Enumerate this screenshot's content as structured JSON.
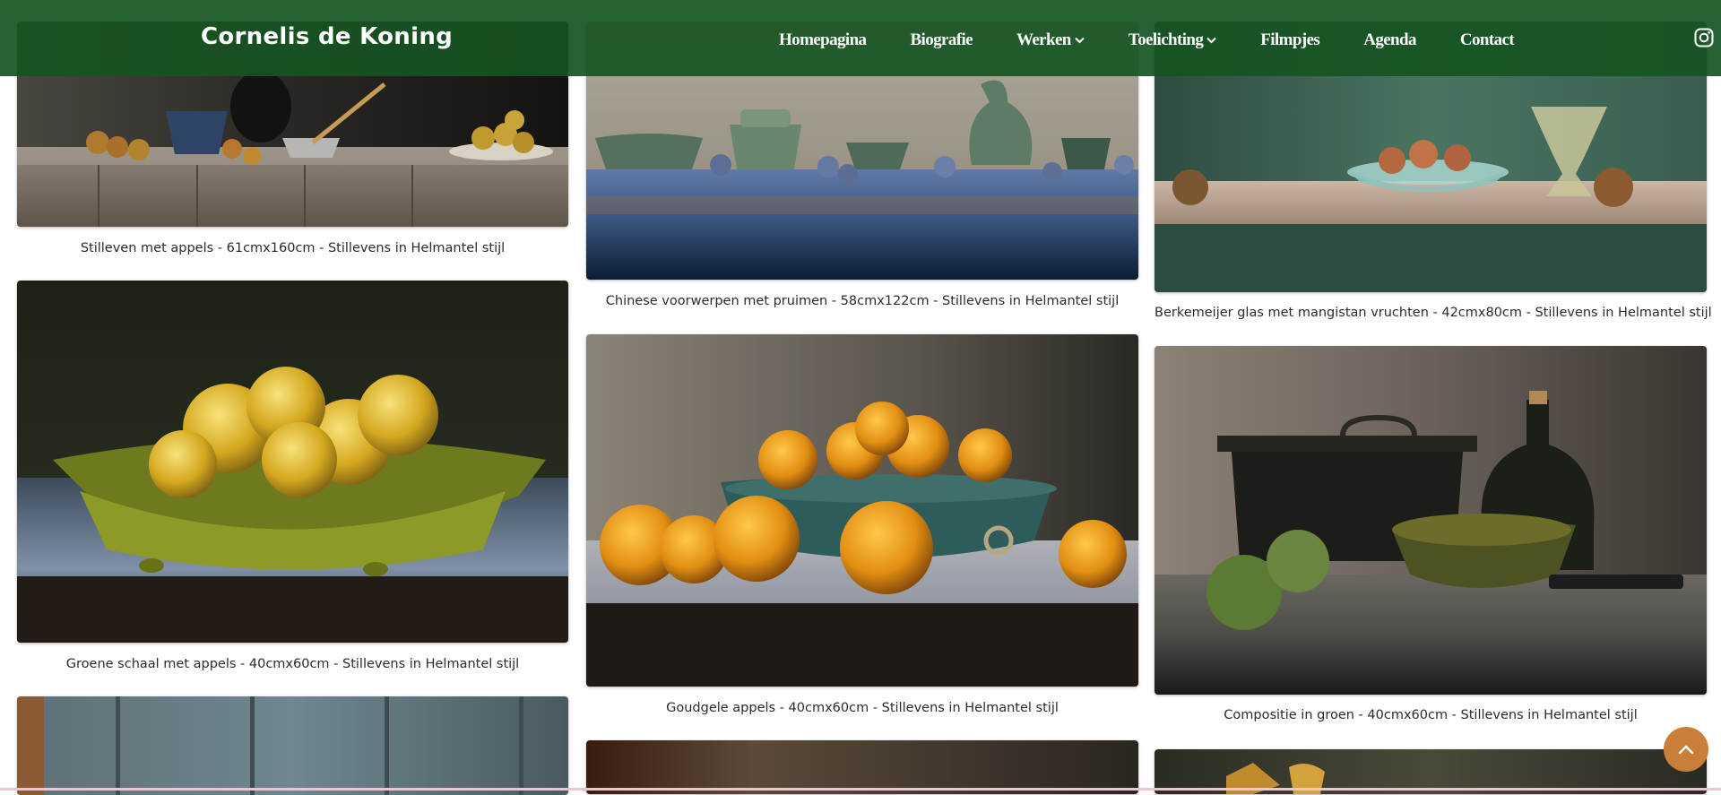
{
  "site": {
    "title": "Cornelis de Koning"
  },
  "nav": {
    "items": [
      {
        "label": "Homepagina",
        "dropdown": false
      },
      {
        "label": "Biografie",
        "dropdown": false
      },
      {
        "label": "Werken",
        "dropdown": true
      },
      {
        "label": "Toelichting",
        "dropdown": true
      },
      {
        "label": "Filmpjes",
        "dropdown": false
      },
      {
        "label": "Agenda",
        "dropdown": false
      },
      {
        "label": "Contact",
        "dropdown": false
      }
    ]
  },
  "icons": {
    "social": "instagram-icon",
    "back_to_top": "chevron-up-icon",
    "dropdown": "chevron-down-icon"
  },
  "colors": {
    "header": "#165422",
    "accent": "#c97f3a",
    "caption_text": "#2b2b2b"
  },
  "gallery": {
    "artworks": [
      {
        "caption": "Stilleven met appels - 61cmx160cm - Stillevens in Helmantel stijl"
      },
      {
        "caption": "Chinese voorwerpen met pruimen - 58cmx122cm - Stillevens in Helmantel stijl"
      },
      {
        "caption": "Berkemeijer glas met mangistan vruchten - 42cmx80cm - Stillevens in Helmantel stijl"
      },
      {
        "caption": "Groene schaal met appels - 40cmx60cm - Stillevens in Helmantel stijl"
      },
      {
        "caption": "Goudgele appels - 40cmx60cm - Stillevens in Helmantel stijl"
      },
      {
        "caption": "Compositie in groen - 40cmx60cm - Stillevens in Helmantel stijl"
      }
    ]
  }
}
